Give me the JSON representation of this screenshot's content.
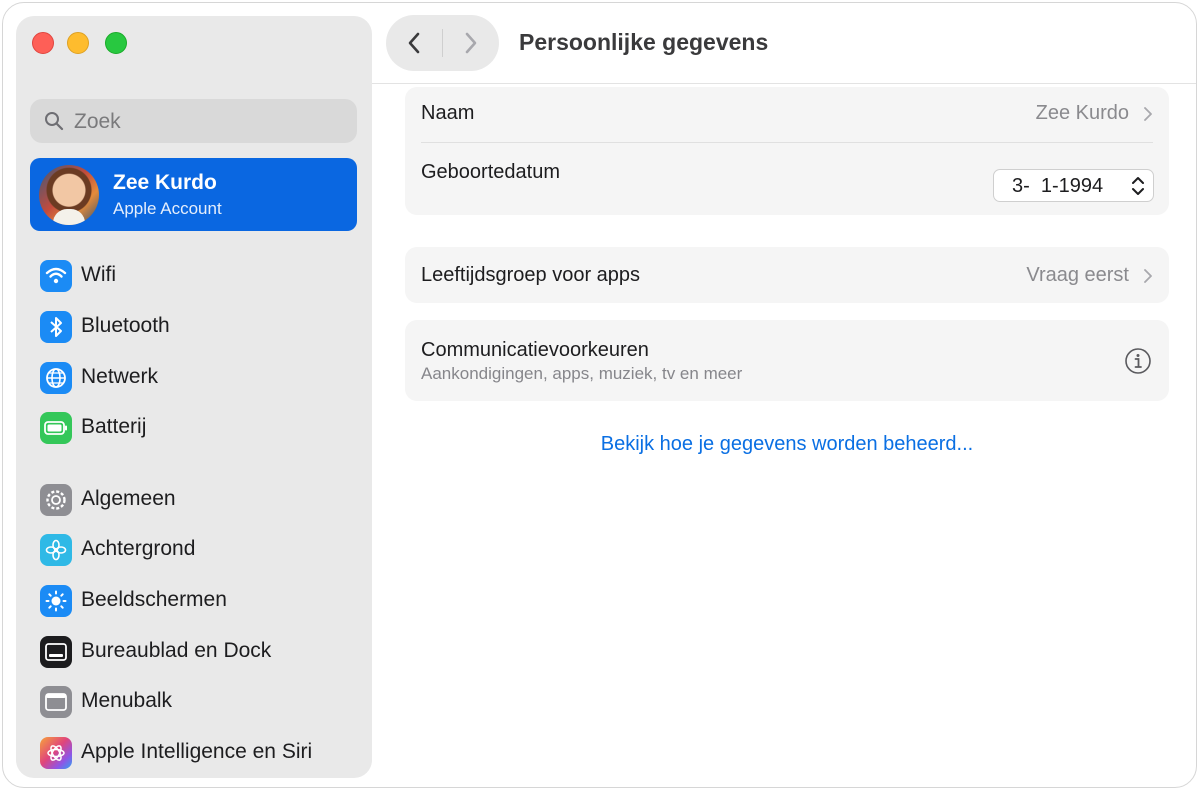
{
  "window": {
    "title": "Persoonlijke gegevens"
  },
  "search": {
    "placeholder": "Zoek"
  },
  "account": {
    "name": "Zee Kurdo",
    "subtitle": "Apple Account"
  },
  "sidebar": {
    "items": [
      {
        "label": "Wifi",
        "icon": "wifi-icon",
        "color": "#1b8bf5"
      },
      {
        "label": "Bluetooth",
        "icon": "bluetooth-icon",
        "color": "#1b8bf5"
      },
      {
        "label": "Netwerk",
        "icon": "globe-icon",
        "color": "#1b8bf5"
      },
      {
        "label": "Batterij",
        "icon": "battery-icon",
        "color": "#34c759"
      },
      {
        "label": "Algemeen",
        "icon": "gear-icon",
        "color": "#8e8e93"
      },
      {
        "label": "Achtergrond",
        "icon": "flower-icon",
        "color": "#2fb9e6"
      },
      {
        "label": "Beeldschermen",
        "icon": "sun-icon",
        "color": "#1b8bf5"
      },
      {
        "label": "Bureaublad en Dock",
        "icon": "dock-icon",
        "color": "#1c1c1e"
      },
      {
        "label": "Menubalk",
        "icon": "menubar-icon",
        "color": "#8e8e93"
      },
      {
        "label": "Apple Intelligence en Siri",
        "icon": "siri-icon",
        "color": "#e0457b"
      }
    ]
  },
  "content": {
    "name_label": "Naam",
    "name_value": "Zee Kurdo",
    "birthdate_label": "Geboortedatum",
    "birthdate_value": "3-  1-1994",
    "age_group_label": "Leeftijdsgroep voor apps",
    "age_group_value": "Vraag eerst",
    "comm_label": "Communicatievoorkeuren",
    "comm_sub": "Aankondigingen, apps, muziek, tv en meer",
    "link_text": "Bekijk hoe je gegevens worden beheerd..."
  }
}
